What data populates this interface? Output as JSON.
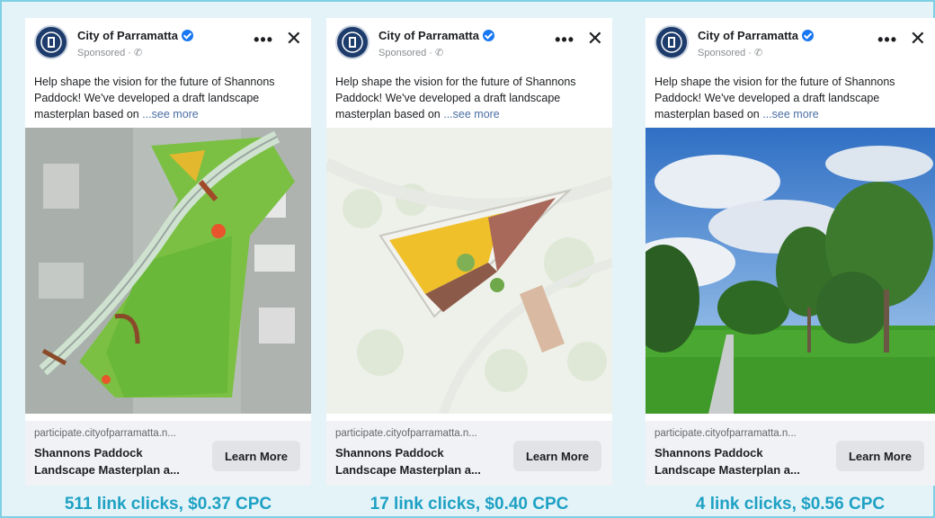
{
  "ads": [
    {
      "page_name": "City of Parramatta",
      "sponsored": "Sponsored · ✆",
      "text": "Help shape the vision for the future of Shannons Paddock! We've developed a draft landscape masterplan based on",
      "see_more": "...see more",
      "domain": "participate.cityofparramatta.n...",
      "headline": "Shannons Paddock Landscape Masterplan a...",
      "cta": "Learn More",
      "stat": "511 link clicks, $0.37 CPC",
      "media": "masterplan-aerial-map"
    },
    {
      "page_name": "City of Parramatta",
      "sponsored": "Sponsored · ✆",
      "text": "Help shape the vision for the future of Shannons Paddock! We've developed a draft landscape masterplan based on",
      "see_more": "...see more",
      "domain": "participate.cityofparramatta.n...",
      "headline": "Shannons Paddock Landscape Masterplan a...",
      "cta": "Learn More",
      "stat": "17 link clicks, $0.40 CPC",
      "media": "masterplan-detail-map"
    },
    {
      "page_name": "City of Parramatta",
      "sponsored": "Sponsored · ✆",
      "text": "Help shape the vision for the future of Shannons Paddock! We've developed a draft landscape masterplan based on",
      "see_more": "...see more",
      "domain": "participate.cityofparramatta.n...",
      "headline": "Shannons Paddock Landscape Masterplan a...",
      "cta": "Learn More",
      "stat": "4 link clicks, $0.56 CPC",
      "media": "park-photo"
    }
  ],
  "colors": {
    "accent_stat": "#1ea1c4",
    "verified": "#1877f2",
    "border": "#7fd0e4"
  },
  "icons": {
    "more": "more-options-icon",
    "close": "close-icon",
    "verified": "verified-badge-icon",
    "logo": "city-logo-icon"
  }
}
